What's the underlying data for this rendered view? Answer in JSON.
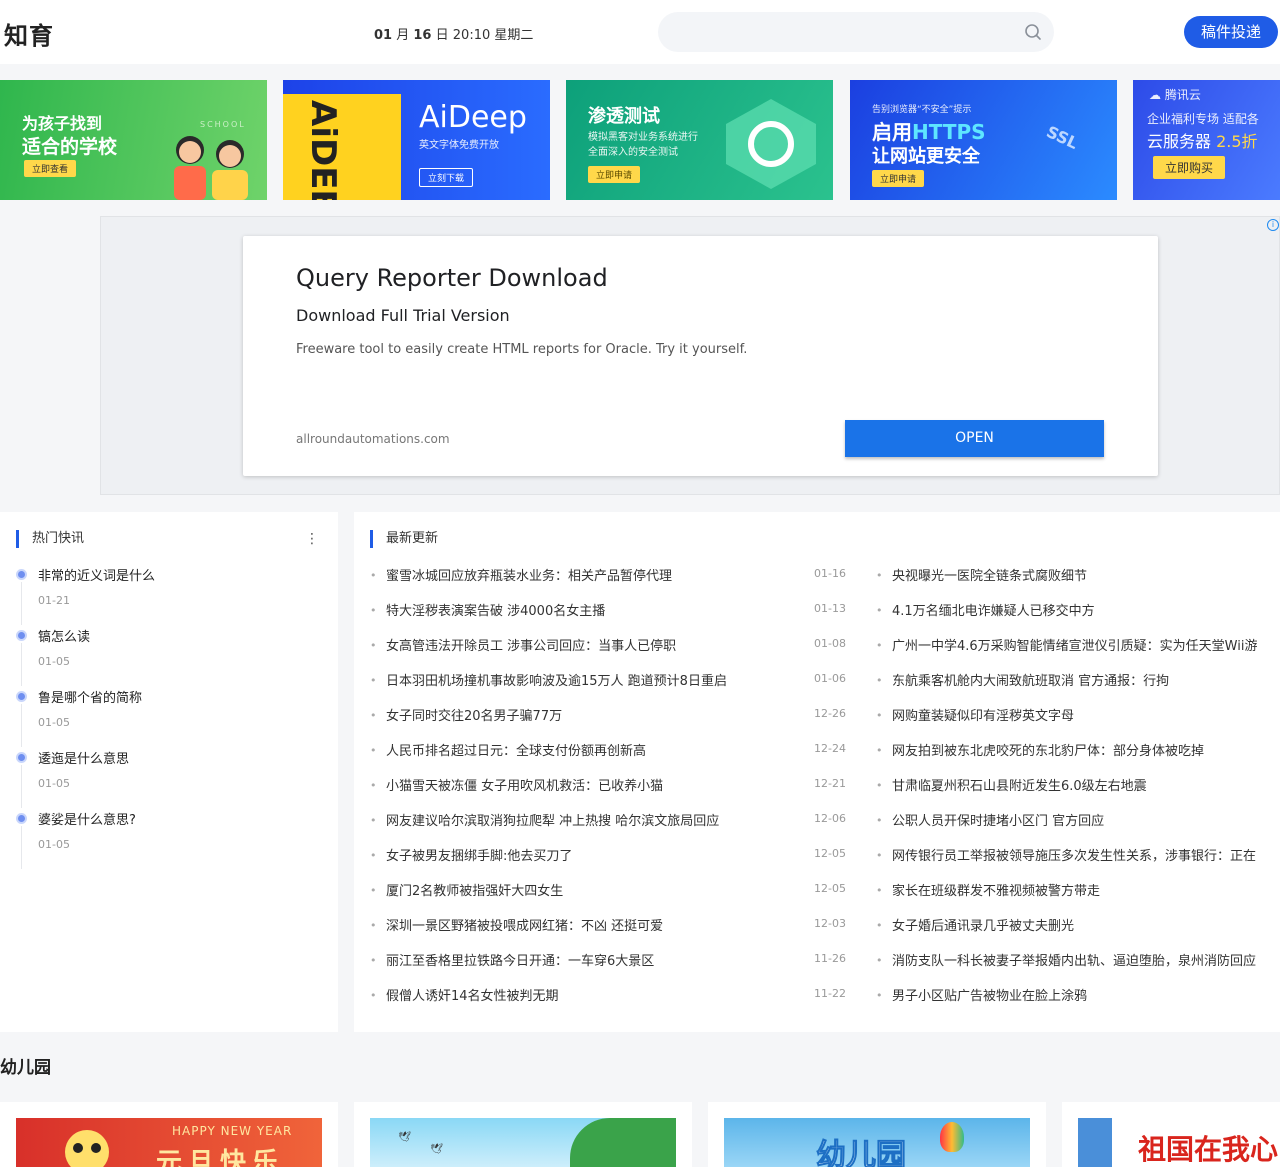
{
  "header": {
    "logo": "知育",
    "date": {
      "month": "01",
      "month_unit": "月",
      "day": "16",
      "day_unit": "日",
      "time": "20:10",
      "weekday": "星期二"
    },
    "search_placeholder": "",
    "submit_label": "稿件投递"
  },
  "banners": [
    {
      "line1": "为孩子找到",
      "line2": "适合的学校",
      "button": "立即查看",
      "tag": "SCHOOL"
    },
    {
      "side_text": "AiDEEP",
      "brand": "AiDeep",
      "sub": "英文字体免费开放",
      "button": "立刻下载"
    },
    {
      "title": "渗透测试",
      "desc1": "模拟黑客对业务系统进行",
      "desc2": "全面深入的安全测试",
      "button": "立即申请"
    },
    {
      "small": "告别浏览器“不安全”提示",
      "line1": "启用",
      "line1_accent": "HTTPS",
      "line2": "让网站更安全",
      "button": "立即申请",
      "tag": "SSL"
    },
    {
      "brand": "腾讯云",
      "line1": "企业福利专场 适配各",
      "line2": "云服务器",
      "line2_accent": "2.5折",
      "button": "立即购买"
    }
  ],
  "ad": {
    "info": "i",
    "title": "Query Reporter Download",
    "subtitle": "Download Full Trial Version",
    "description": "Freeware tool to easily create HTML reports for Oracle. Try it yourself.",
    "url": "allroundautomations.com",
    "button": "OPEN"
  },
  "hot": {
    "heading": "热门快讯",
    "items": [
      {
        "title": "非常的近义词是什么",
        "date": "01-21"
      },
      {
        "title": "镐怎么读",
        "date": "01-05"
      },
      {
        "title": "鲁是哪个省的简称",
        "date": "01-05"
      },
      {
        "title": "逶迤是什么意思",
        "date": "01-05"
      },
      {
        "title": "婆娑是什么意思?",
        "date": "01-05"
      }
    ]
  },
  "latest": {
    "heading": "最新更新",
    "col1": [
      {
        "title": "蜜雪冰城回应放弃瓶装水业务：相关产品暂停代理",
        "date": "01-16"
      },
      {
        "title": "特大淫秽表演案告破 涉4000名女主播",
        "date": "01-13"
      },
      {
        "title": "女高管违法开除员工 涉事公司回应：当事人已停职",
        "date": "01-08"
      },
      {
        "title": "日本羽田机场撞机事故影响波及逾15万人 跑道预计8日重启",
        "date": "01-06"
      },
      {
        "title": "女子同时交往20名男子骗77万",
        "date": "12-26"
      },
      {
        "title": "人民币排名超过日元：全球支付份额再创新高",
        "date": "12-24"
      },
      {
        "title": "小猫雪天被冻僵 女子用吹风机救活：已收养小猫",
        "date": "12-21"
      },
      {
        "title": "网友建议哈尔滨取消狗拉爬犁 冲上热搜 哈尔滨文旅局回应",
        "date": "12-06"
      },
      {
        "title": "女子被男友捆绑手脚:他去买刀了",
        "date": "12-05"
      },
      {
        "title": "厦门2名教师被指强奸大四女生",
        "date": "12-05"
      },
      {
        "title": "深圳一景区野猪被投喂成网红猪：不凶 还挺可爱",
        "date": "12-03"
      },
      {
        "title": "丽江至香格里拉铁路今日开通：一车穿6大景区",
        "date": "11-26"
      },
      {
        "title": "假僧人诱奸14名女性被判无期",
        "date": "11-22"
      }
    ],
    "col2": [
      {
        "title": "央视曝光一医院全链条式腐败细节"
      },
      {
        "title": "4.1万名缅北电诈嫌疑人已移交中方"
      },
      {
        "title": "广州一中学4.6万采购智能情绪宣泄仪引质疑：实为任天堂Wii游"
      },
      {
        "title": "东航乘客机舱内大闹致航班取消 官方通报：行拘"
      },
      {
        "title": "网购童装疑似印有淫秽英文字母"
      },
      {
        "title": "网友拍到被东北虎咬死的东北豹尸体：部分身体被吃掉"
      },
      {
        "title": "甘肃临夏州积石山县附近发生6.0级左右地震"
      },
      {
        "title": "公职人员开保时捷堵小区门 官方回应"
      },
      {
        "title": "网传银行员工举报被领导施压多次发生性关系，涉事银行：正在"
      },
      {
        "title": "家长在班级群发不雅视频被警方带走"
      },
      {
        "title": "女子婚后通讯录几乎被丈夫删光"
      },
      {
        "title": "消防支队一科长被妻子举报婚内出轨、逼迫堕胎，泉州消防回应"
      },
      {
        "title": "男子小区贴广告被物业在脸上涂鸦"
      }
    ]
  },
  "kindergarten": {
    "title": "幼儿园",
    "cards": [
      {
        "text1": "HAPPY NEW YEAR",
        "text2": "元旦快乐"
      },
      {
        "text1": ""
      },
      {
        "text1": "幼儿园"
      },
      {
        "text1": "祖国在我心"
      }
    ]
  },
  "colors": {
    "accent": "#1f5ce6",
    "ad_button": "#1a73e8"
  }
}
